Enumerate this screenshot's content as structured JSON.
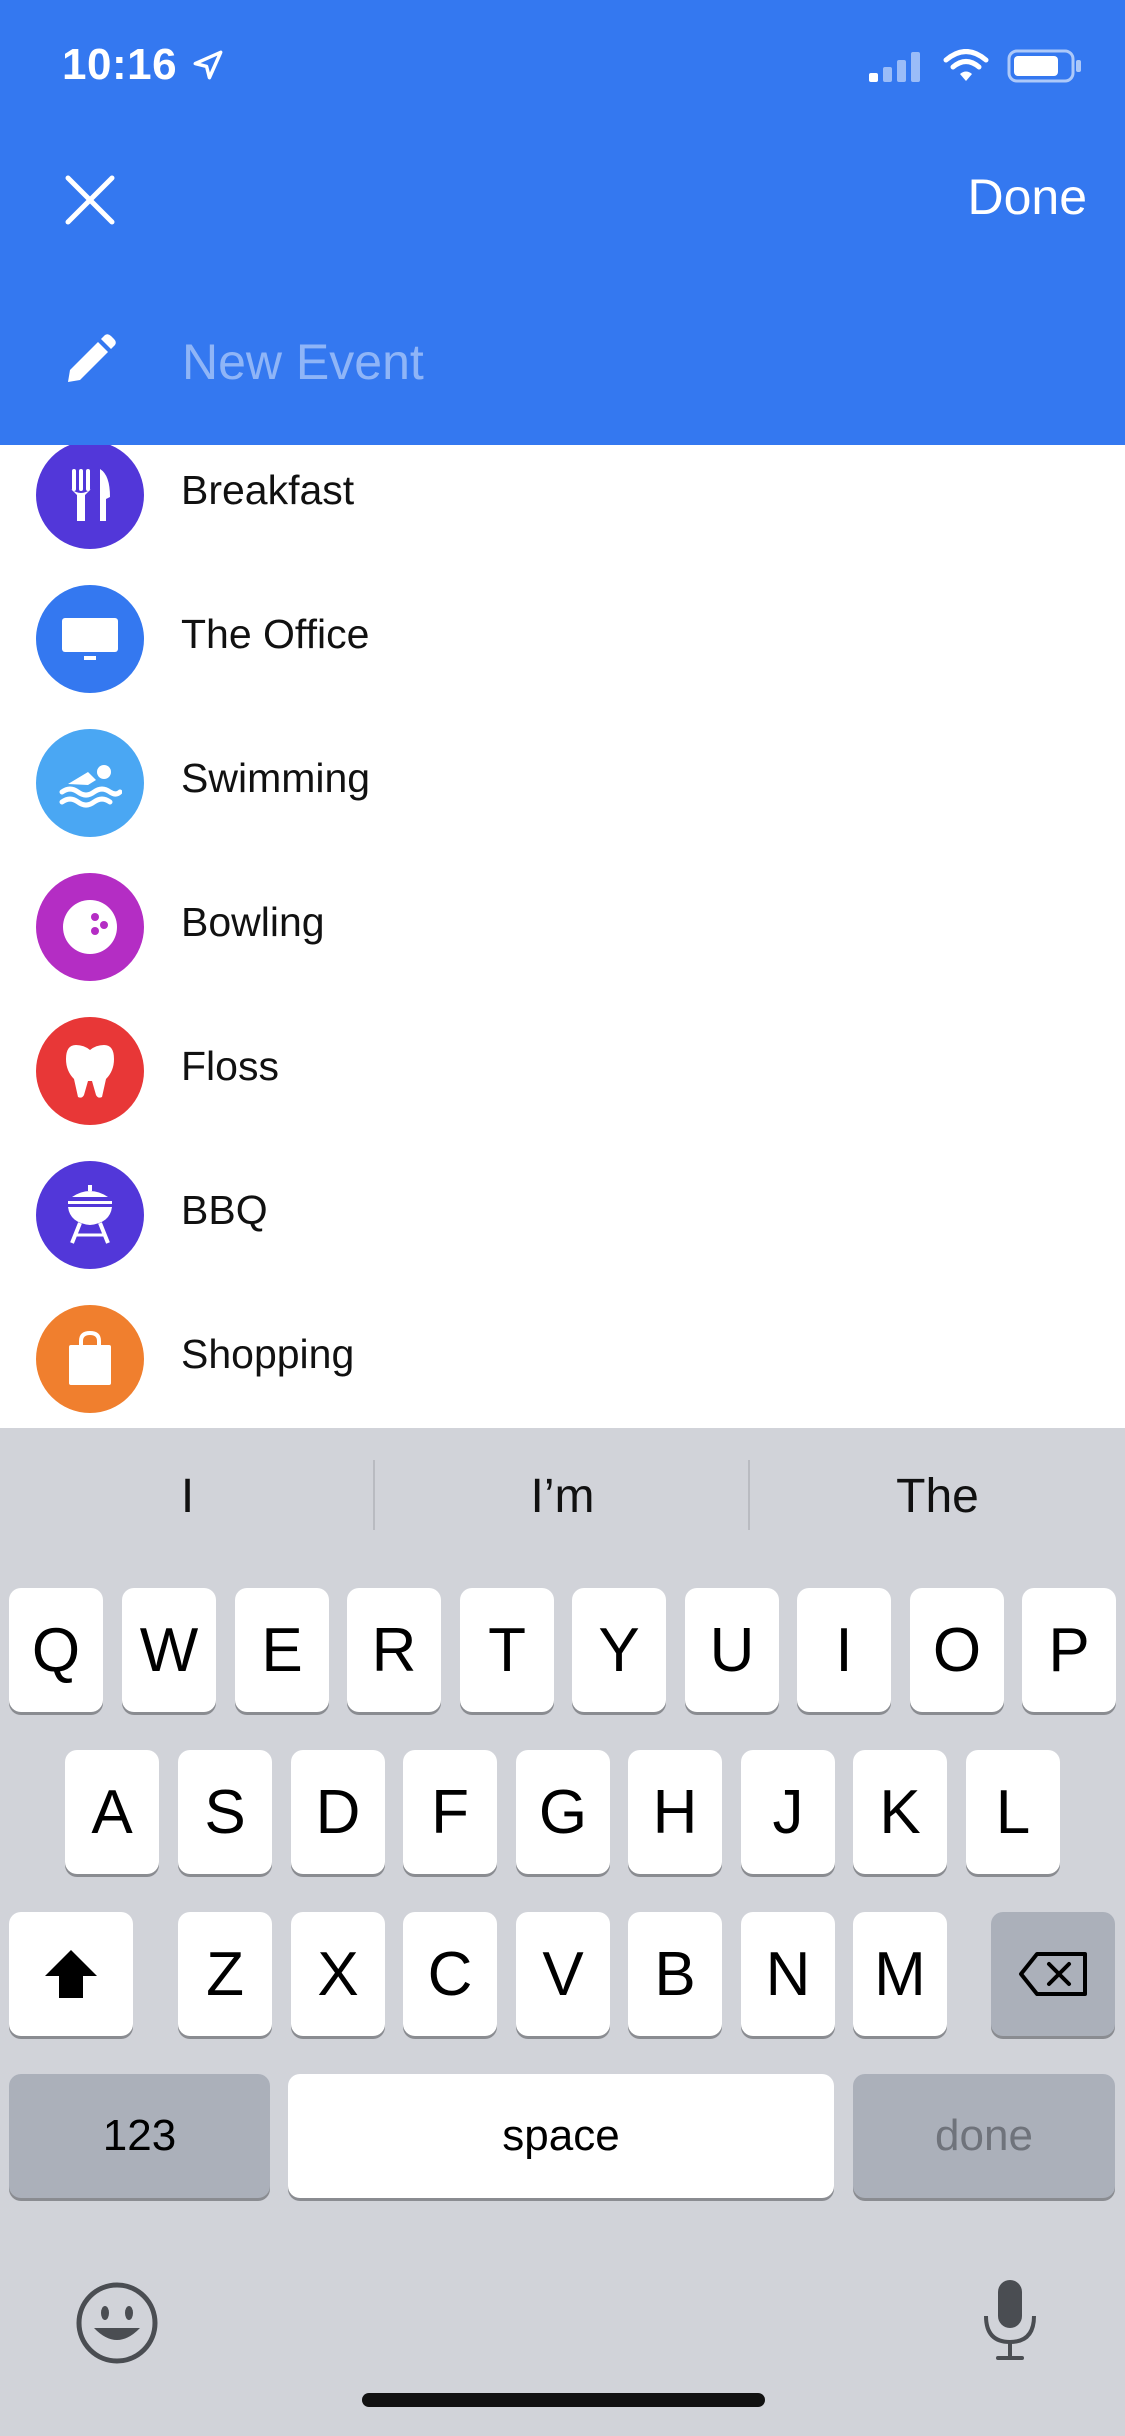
{
  "status_bar": {
    "time": "10:16"
  },
  "header": {
    "done_label": "Done",
    "title_placeholder": "New Event"
  },
  "colors": {
    "header_bg": "#3478F0"
  },
  "suggestions": [
    {
      "icon": "fork-knife-icon",
      "label": "Breakfast",
      "color": "#5237D9"
    },
    {
      "icon": "tv-icon",
      "label": "The Office",
      "color": "#3478F0"
    },
    {
      "icon": "swimmer-icon",
      "label": "Swimming",
      "color": "#4AA7F3"
    },
    {
      "icon": "bowling-ball-icon",
      "label": "Bowling",
      "color": "#B42DC4"
    },
    {
      "icon": "tooth-icon",
      "label": "Floss",
      "color": "#E83737"
    },
    {
      "icon": "bbq-grill-icon",
      "label": "BBQ",
      "color": "#5237D9"
    },
    {
      "icon": "shopping-bag-icon",
      "label": "Shopping",
      "color": "#F07F2E"
    }
  ],
  "keyboard": {
    "predictions": [
      "I",
      "I’m",
      "The"
    ],
    "row1": [
      "Q",
      "W",
      "E",
      "R",
      "T",
      "Y",
      "U",
      "I",
      "O",
      "P"
    ],
    "row2": [
      "A",
      "S",
      "D",
      "F",
      "G",
      "H",
      "J",
      "K",
      "L"
    ],
    "row3": [
      "Z",
      "X",
      "C",
      "V",
      "B",
      "N",
      "M"
    ],
    "numbers_label": "123",
    "space_label": "space",
    "return_label": "done"
  }
}
